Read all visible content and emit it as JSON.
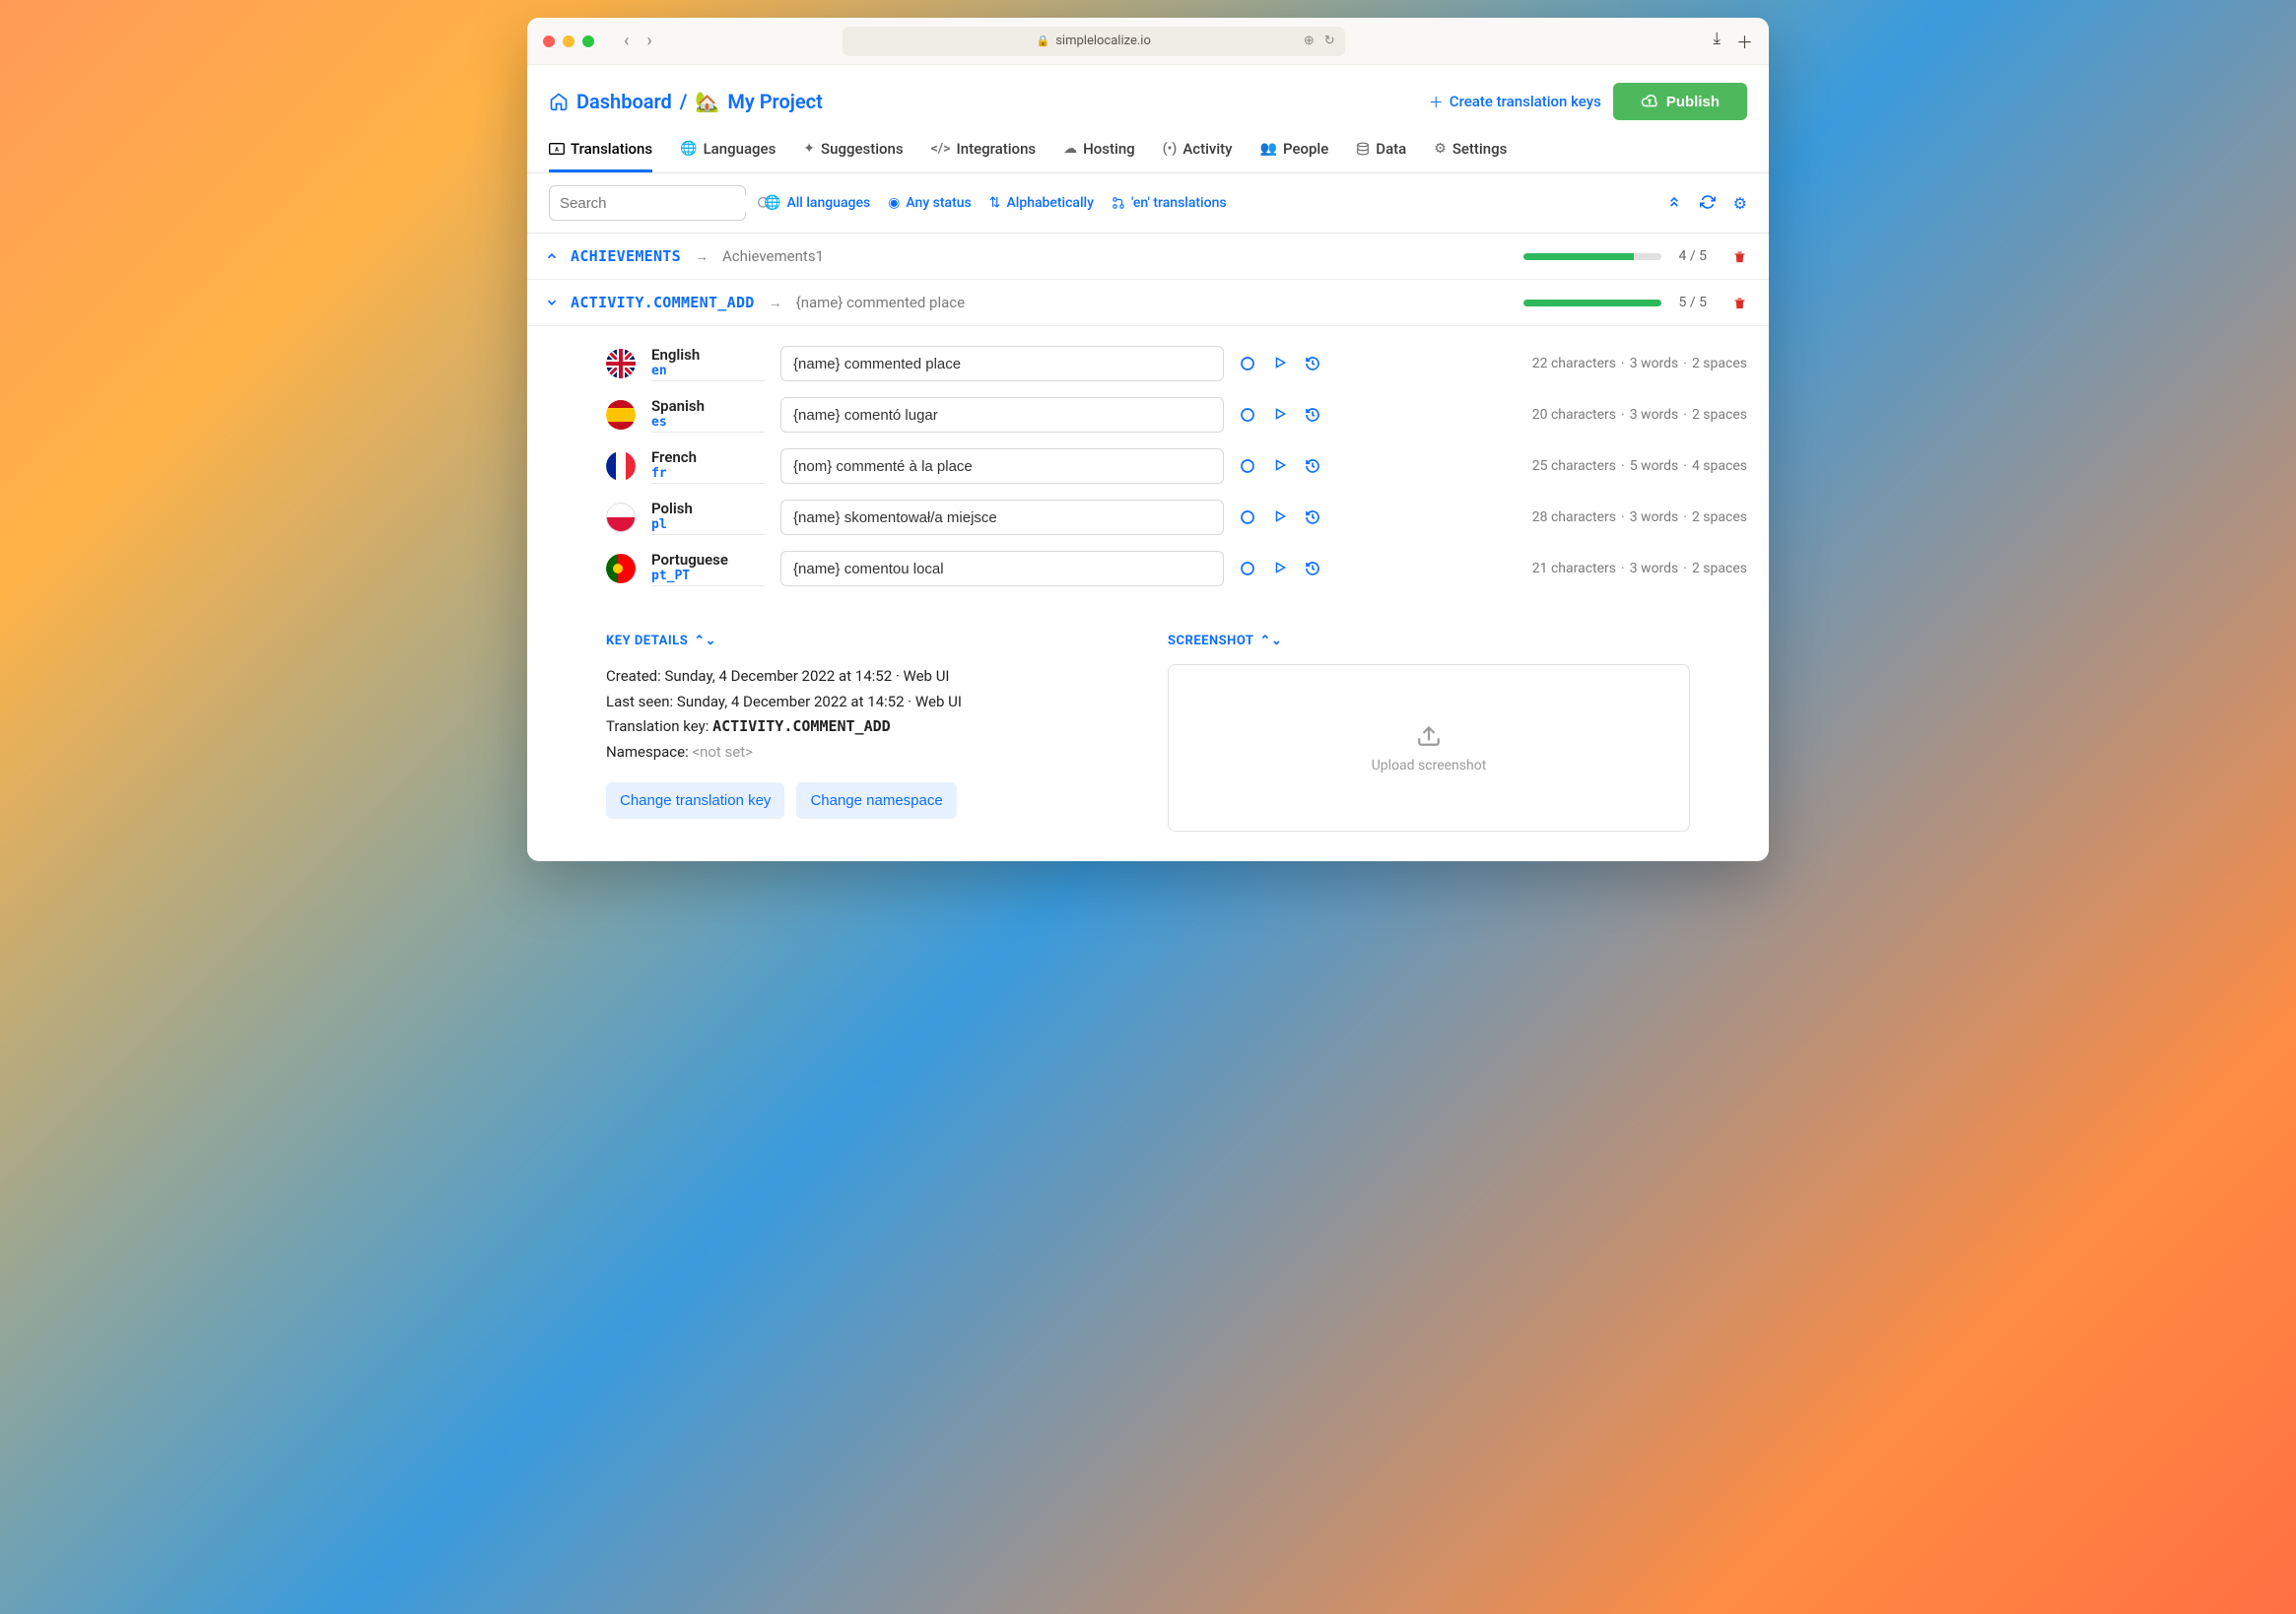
{
  "browser": {
    "url": "simplelocalize.io"
  },
  "breadcrumb": {
    "dashboard": "Dashboard",
    "project": "My Project"
  },
  "header": {
    "create_keys": "Create translation keys",
    "publish": "Publish"
  },
  "tabs": {
    "translations": "Translations",
    "languages": "Languages",
    "suggestions": "Suggestions",
    "integrations": "Integrations",
    "hosting": "Hosting",
    "activity": "Activity",
    "people": "People",
    "data": "Data",
    "settings": "Settings"
  },
  "filters": {
    "search_placeholder": "Search",
    "all_languages": "All languages",
    "any_status": "Any status",
    "alphabetically": "Alphabetically",
    "en_translations": "'en' translations"
  },
  "keys": [
    {
      "name": "ACHIEVEMENTS",
      "preview": "Achievements1",
      "progress": {
        "done": 4,
        "total": 5,
        "pct": 80
      },
      "expanded": false
    },
    {
      "name": "ACTIVITY.COMMENT_ADD",
      "preview": "{name} commented place",
      "progress": {
        "done": 5,
        "total": 5,
        "pct": 100
      },
      "expanded": true
    }
  ],
  "translations": [
    {
      "lang": "English",
      "code": "en",
      "value": "{name} commented place",
      "chars": 22,
      "words": 3,
      "spaces": 2
    },
    {
      "lang": "Spanish",
      "code": "es",
      "value": "{name} comentó lugar",
      "chars": 20,
      "words": 3,
      "spaces": 2
    },
    {
      "lang": "French",
      "code": "fr",
      "value": "{nom} commenté à la place",
      "chars": 25,
      "words": 5,
      "spaces": 4
    },
    {
      "lang": "Polish",
      "code": "pl",
      "value": "{name} skomentował/a miejsce",
      "chars": 28,
      "words": 3,
      "spaces": 2
    },
    {
      "lang": "Portuguese",
      "code": "pt_PT",
      "value": "{name} comentou local",
      "chars": 21,
      "words": 3,
      "spaces": 2
    }
  ],
  "details": {
    "heading": "KEY DETAILS",
    "created_label": "Created:",
    "created_value": "Sunday, 4 December 2022 at 14:52",
    "created_source": "Web UI",
    "lastseen_label": "Last seen:",
    "lastseen_value": "Sunday, 4 December 2022 at 14:52",
    "lastseen_source": "Web UI",
    "tkey_label": "Translation key:",
    "tkey_value": "ACTIVITY.COMMENT_ADD",
    "namespace_label": "Namespace:",
    "namespace_value": "<not set>",
    "change_key_btn": "Change translation key",
    "change_ns_btn": "Change namespace"
  },
  "screenshot": {
    "heading": "SCREENSHOT",
    "upload_label": "Upload screenshot"
  },
  "stats_labels": {
    "chars": "characters",
    "words": "words",
    "spaces": "spaces"
  }
}
